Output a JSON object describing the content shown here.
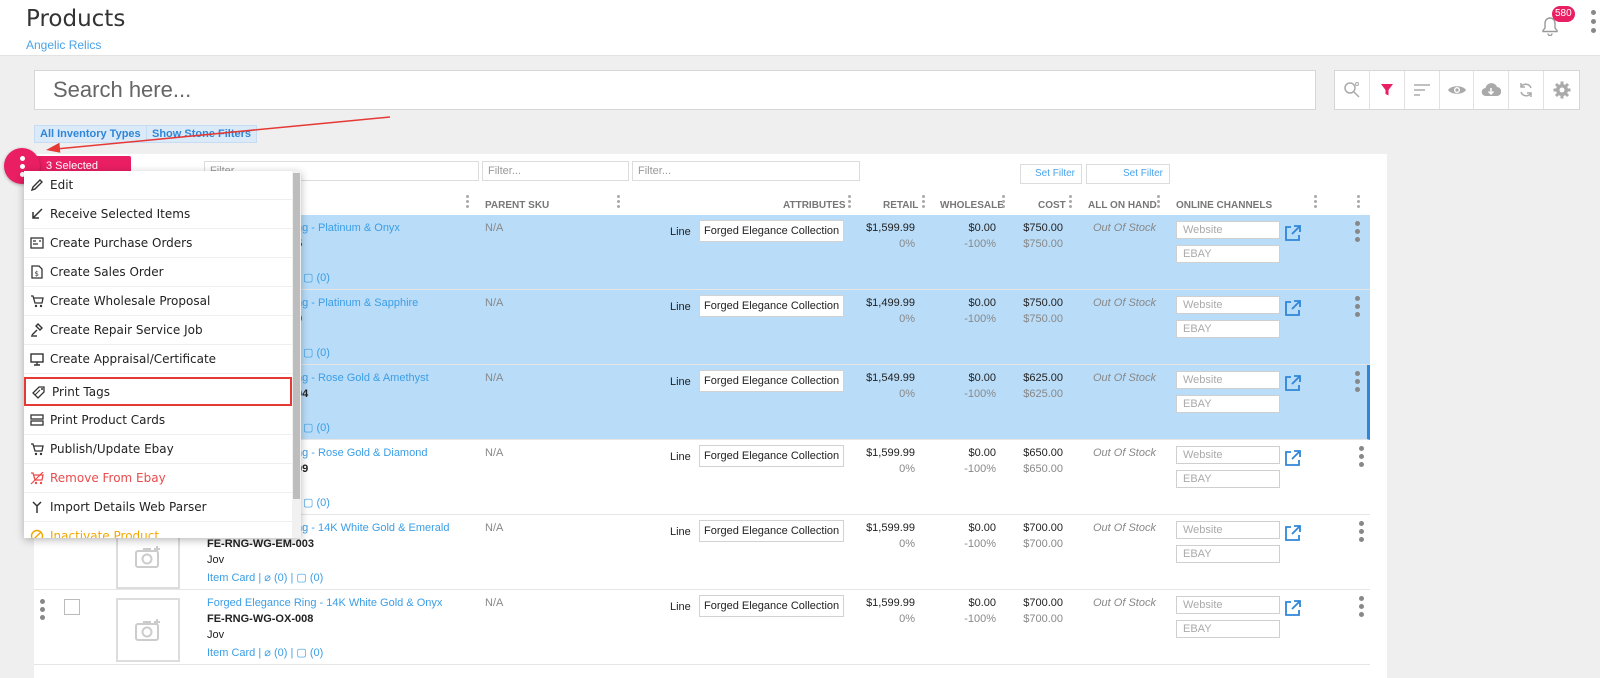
{
  "header": {
    "title": "Products",
    "subtitle": "Angelic Relics",
    "notifications": "580"
  },
  "search": {
    "placeholder": "Search here..."
  },
  "filters": {
    "inventory_types": "All Inventory Types",
    "stone_filters": "Show Stone Filters"
  },
  "selection": {
    "label": "3 Selected"
  },
  "table": {
    "filter_placeholder": "Filter...",
    "set_filter": "Set Filter",
    "columns": [
      "PARENT SKU",
      "ATTRIBUTES",
      "RETAIL",
      "WHOLESALE",
      "COST",
      "ALL ON HAND",
      "ONLINE CHANNELS"
    ],
    "rows": [
      {
        "name_visible": "ng - Platinum & Onyx",
        "sku_visible": "5",
        "parent": "N/A",
        "line": "Line",
        "collection": "Forged Elegance Collection",
        "retail": "$1,599.99",
        "retail_pct": "0%",
        "wholesale": "$0.00",
        "wholesale_pct": "-100%",
        "cost": "$750.00",
        "cost2": "$750.00",
        "on_hand": "Out Of Stock",
        "ch1": "Website",
        "ch2": "EBAY",
        "links": "(0)",
        "selected": true
      },
      {
        "name_visible": "ng - Platinum & Sapphire",
        "sku_visible": "0",
        "parent": "N/A",
        "line": "Line",
        "collection": "Forged Elegance Collection",
        "retail": "$1,499.99",
        "retail_pct": "0%",
        "wholesale": "$0.00",
        "wholesale_pct": "-100%",
        "cost": "$750.00",
        "cost2": "$750.00",
        "on_hand": "Out Of Stock",
        "ch1": "Website",
        "ch2": "EBAY",
        "links": "(0)",
        "selected": true
      },
      {
        "name_visible": "ng - Rose Gold & Amethyst",
        "sku_visible": "04",
        "parent": "N/A",
        "line": "Line",
        "collection": "Forged Elegance Collection",
        "retail": "$1,549.99",
        "retail_pct": "0%",
        "wholesale": "$0.00",
        "wholesale_pct": "-100%",
        "cost": "$625.00",
        "cost2": "$625.00",
        "on_hand": "Out Of Stock",
        "ch1": "Website",
        "ch2": "EBAY",
        "links": "(0)",
        "selected": true
      },
      {
        "name_visible": "ng - Rose Gold & Diamond",
        "sku_visible": "09",
        "parent": "N/A",
        "line": "Line",
        "collection": "Forged Elegance Collection",
        "retail": "$1,599.99",
        "retail_pct": "0%",
        "wholesale": "$0.00",
        "wholesale_pct": "-100%",
        "cost": "$650.00",
        "cost2": "$650.00",
        "on_hand": "Out Of Stock",
        "ch1": "Website",
        "ch2": "EBAY",
        "links": "(0)",
        "selected": false
      },
      {
        "name_visible": "ng - 14K White Gold & Emerald",
        "sku": "FE-RNG-WG-EM-003",
        "brand": "Jov",
        "item_card": "Item Card",
        "parent": "N/A",
        "line": "Line",
        "collection": "Forged Elegance Collection",
        "retail": "$1,599.99",
        "retail_pct": "0%",
        "wholesale": "$0.00",
        "wholesale_pct": "-100%",
        "cost": "$700.00",
        "cost2": "$700.00",
        "on_hand": "Out Of Stock",
        "ch1": "Website",
        "ch2": "EBAY",
        "links": "(0)",
        "selected": false
      },
      {
        "name": "Forged Elegance Ring - 14K White Gold & Onyx",
        "sku": "FE-RNG-WG-OX-008",
        "brand": "Jov",
        "item_card": "Item Card",
        "parent": "N/A",
        "line": "Line",
        "collection": "Forged Elegance Collection",
        "retail": "$1,599.99",
        "retail_pct": "0%",
        "wholesale": "$0.00",
        "wholesale_pct": "-100%",
        "cost": "$700.00",
        "cost2": "$700.00",
        "on_hand": "Out Of Stock",
        "ch1": "Website",
        "ch2": "EBAY",
        "links": "(0)",
        "selected": false
      }
    ]
  },
  "menu": {
    "items": [
      {
        "label": "Edit",
        "icon": "pencil-icon"
      },
      {
        "label": "Receive Selected Items",
        "icon": "arrow-down-left-icon"
      },
      {
        "label": "Create Purchase Orders",
        "icon": "purchase-order-icon"
      },
      {
        "label": "Create Sales Order",
        "icon": "dollar-document-icon"
      },
      {
        "label": "Create Wholesale Proposal",
        "icon": "cart-icon"
      },
      {
        "label": "Create Repair Service Job",
        "icon": "repair-icon"
      },
      {
        "label": "Create Appraisal/Certificate",
        "icon": "monitor-icon"
      },
      {
        "label": "Print Tags",
        "icon": "tags-icon"
      },
      {
        "label": "Print Product Cards",
        "icon": "cards-icon"
      },
      {
        "label": "Publish/Update Ebay",
        "icon": "cart-icon"
      },
      {
        "label": "Remove From Ebay",
        "icon": "cart-remove-icon"
      },
      {
        "label": "Import Details Web Parser",
        "icon": "merge-icon"
      },
      {
        "label": "Inactivate Product",
        "icon": "inactivate-icon"
      }
    ]
  },
  "colors": {
    "accent": "#e91e63",
    "link": "#3b9ee6",
    "selected_row": "#b9dcf8",
    "highlight": "#e53935"
  }
}
